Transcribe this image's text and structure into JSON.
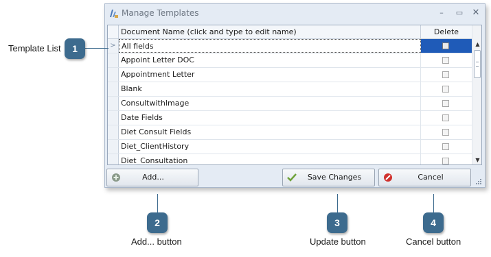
{
  "window": {
    "title": "Manage Templates",
    "min_glyph": "–",
    "max_glyph": "▭",
    "close_glyph": "✕"
  },
  "grid": {
    "col_name_header": "Document Name (click and type to edit name)",
    "col_delete_header": "Delete",
    "current_row_marker": ">",
    "rows": [
      {
        "name": "All fields",
        "selected": true
      },
      {
        "name": "Appoint Letter DOC"
      },
      {
        "name": "Appointment Letter"
      },
      {
        "name": "Blank"
      },
      {
        "name": "ConsultwithImage"
      },
      {
        "name": "Date Fields"
      },
      {
        "name": "Diet Consult Fields"
      },
      {
        "name": "Diet_ClientHistory"
      },
      {
        "name": "Diet_Consultation"
      }
    ]
  },
  "buttons": {
    "add_label": "Add...",
    "save_label": "Save Changes",
    "cancel_label": "Cancel"
  },
  "callouts": {
    "template_list": {
      "number": "1",
      "label": "Template List"
    },
    "add": {
      "number": "2",
      "label": "Add... button"
    },
    "update": {
      "number": "3",
      "label": "Update button"
    },
    "cancel": {
      "number": "4",
      "label": "Cancel button"
    }
  },
  "colors": {
    "badge": "#3d6b8e",
    "selected_cell": "#1f5bb8",
    "window_bg": "#e4ebf4"
  },
  "icons": {
    "app": "templates-app-icon",
    "add": "add-plus-icon",
    "save": "check-mark-icon",
    "cancel": "cancel-icon"
  }
}
